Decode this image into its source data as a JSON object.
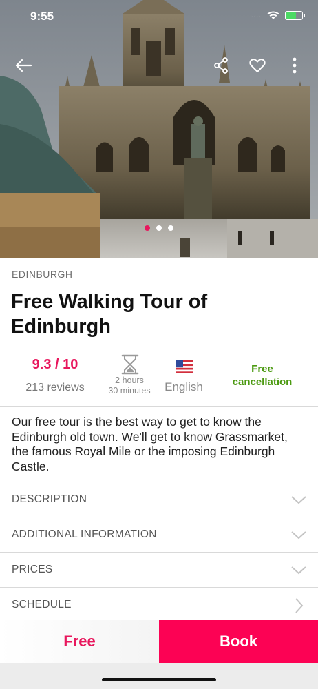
{
  "status_bar": {
    "time": "9:55",
    "signal": "....",
    "battery_color": "#4cd964"
  },
  "hero": {
    "image_subject": "gothic cathedral with statue",
    "icons": [
      "back-arrow-icon",
      "share-icon",
      "heart-icon",
      "more-vertical-icon"
    ],
    "pager": {
      "count": 3,
      "active_index": 0
    }
  },
  "tour": {
    "city": "EDINBURGH",
    "title": "Free Walking Tour of Edinburgh",
    "rating": "9.3 / 10",
    "reviews": "213 reviews",
    "duration_line1": "2 hours",
    "duration_line2": "30 minutes",
    "language": "English",
    "cancellation": "Free cancellation",
    "summary": "Our free tour is the best way to get to know the Edinburgh old town. We'll get to know Grassmarket, the famous Royal Mile or the imposing Edinburgh Castle."
  },
  "sections": [
    {
      "label": "DESCRIPTION",
      "icon": "chevron-down-icon"
    },
    {
      "label": "ADDITIONAL INFORMATION",
      "icon": "chevron-down-icon"
    },
    {
      "label": "PRICES",
      "icon": "chevron-down-icon"
    },
    {
      "label": "SCHEDULE",
      "icon": "chevron-right-icon"
    }
  ],
  "cta": {
    "price": "Free",
    "book_label": "Book"
  },
  "colors": {
    "accent": "#e8175d",
    "book": "#fc0254",
    "success": "#4c9a12"
  }
}
